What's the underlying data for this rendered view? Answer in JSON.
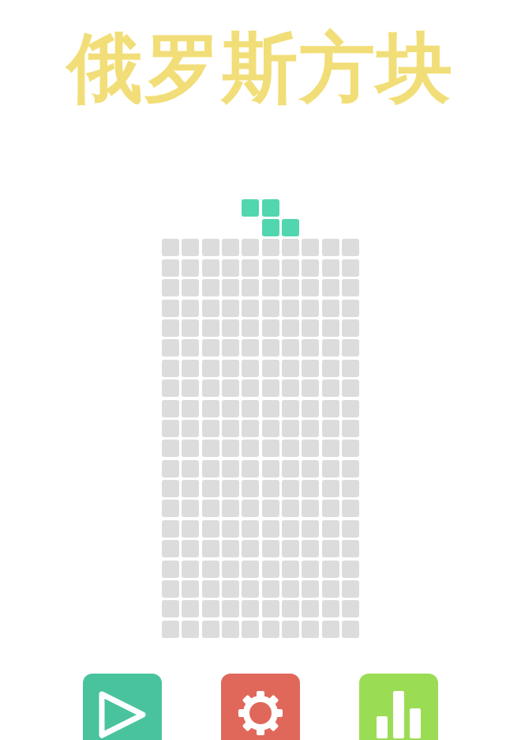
{
  "title": "俄罗斯方块",
  "board": {
    "rows": 20,
    "columns": 10,
    "filled": []
  },
  "active_piece": {
    "cells": [
      [
        -2,
        4
      ],
      [
        -2,
        5
      ],
      [
        -1,
        5
      ],
      [
        -1,
        6
      ]
    ],
    "color": "#52d6b0"
  },
  "menu_buttons": [
    {
      "kind": "play",
      "color": "#48c39e"
    },
    {
      "kind": "settings",
      "color": "#e0685a"
    },
    {
      "kind": "stats",
      "color": "#9bdc55"
    }
  ]
}
